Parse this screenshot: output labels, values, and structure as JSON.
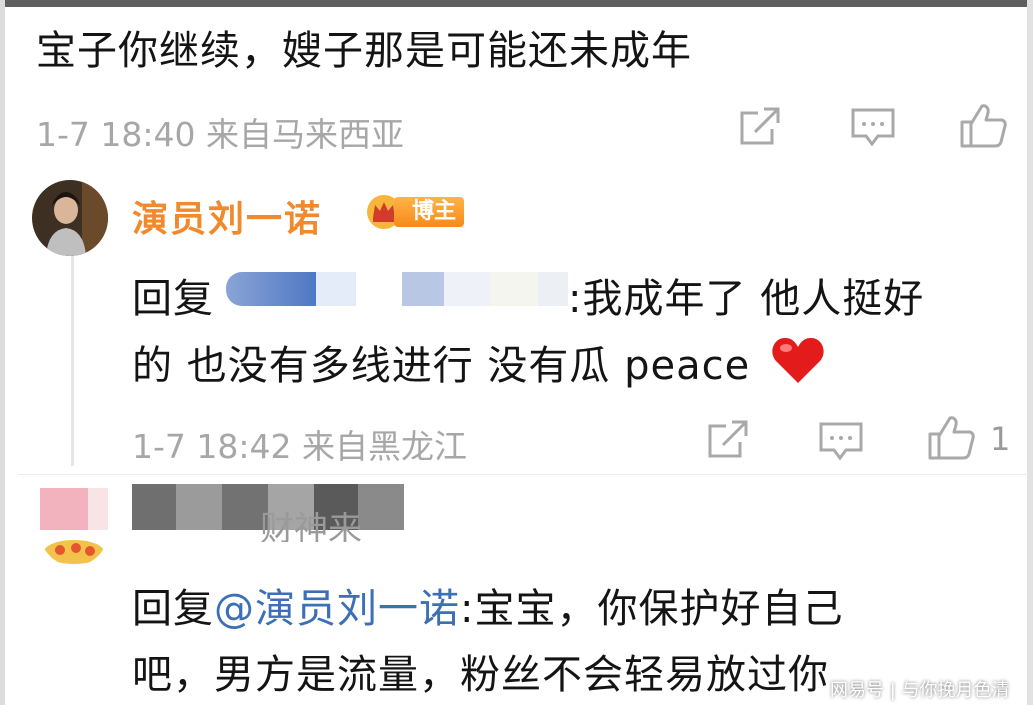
{
  "comment1": {
    "text": "宝子你继续，嫂子那是可能还未成年",
    "meta": "1-7 18:40 来自马来西亚"
  },
  "reply1": {
    "username": "演员刘一诺",
    "badge": "博主",
    "line1_prefix": "回复",
    "line1_suffix": ":我成年了 他人挺好",
    "line2": "的 也没有多线进行 没有瓜 peace",
    "meta": "1-7 18:42 来自黑龙江",
    "like_count": "1"
  },
  "reply2": {
    "username_partial": "财神来",
    "line1_prefix": "回复",
    "mention": "@演员刘一诺",
    "line1_suffix": ":宝宝，你保护好自己",
    "line2": "吧，男方是流量，粉丝不会轻易放过你"
  },
  "watermark": "网易号 | 与你挽月色清",
  "colors": {
    "username": "#f08a2c",
    "mention": "#3b6fb6",
    "meta": "#a7a7a7",
    "badge": "#f48b1a"
  },
  "icons": [
    "share-icon",
    "comment-icon",
    "like-icon",
    "heart-emoji",
    "crown-icon"
  ]
}
